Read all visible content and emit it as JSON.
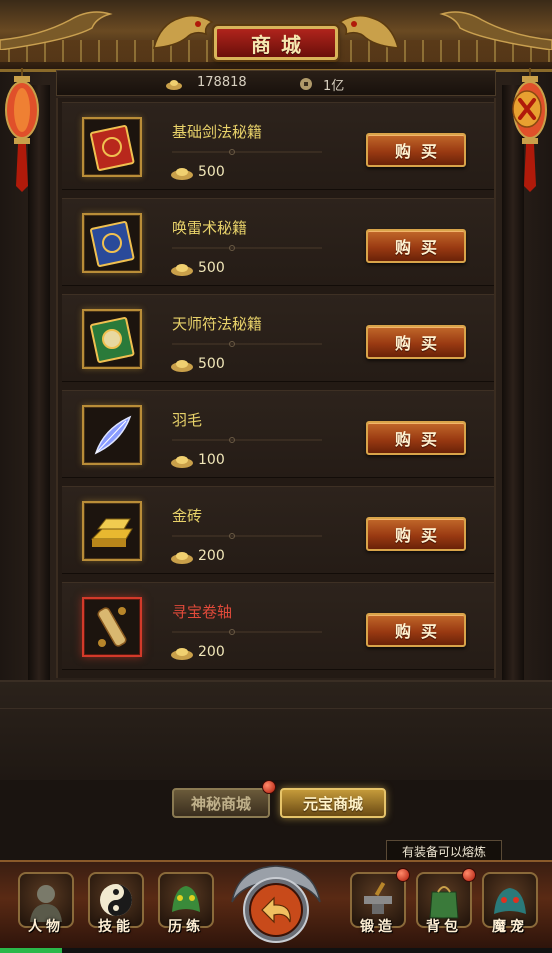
{
  "header": {
    "title": "商城"
  },
  "currency": {
    "gold": "178818",
    "coins": "1亿"
  },
  "items": [
    {
      "name": "基础剑法秘籍",
      "price": "500",
      "icon": "red-book-icon",
      "rare": false
    },
    {
      "name": "唤雷术秘籍",
      "price": "500",
      "icon": "blue-book-icon",
      "rare": false
    },
    {
      "name": "天师符法秘籍",
      "price": "500",
      "icon": "green-book-icon",
      "rare": false
    },
    {
      "name": "羽毛",
      "price": "100",
      "icon": "feather-icon",
      "rare": false
    },
    {
      "name": "金砖",
      "price": "200",
      "icon": "gold-bar-icon",
      "rare": false
    },
    {
      "name": "寻宝卷轴",
      "price": "200",
      "icon": "scroll-icon",
      "rare": true
    }
  ],
  "buy_label": "购买",
  "tabs": [
    {
      "label": "神秘商城",
      "active": false
    },
    {
      "label": "元宝商城",
      "active": true
    }
  ],
  "tooltip": "有装备可以熔炼",
  "nav": [
    {
      "label": "人物",
      "icon": "warrior-icon"
    },
    {
      "label": "技能",
      "icon": "yin-yang-icon"
    },
    {
      "label": "历练",
      "icon": "dragon-head-icon"
    },
    {
      "label": "锻造",
      "icon": "anvil-icon"
    },
    {
      "label": "背包",
      "icon": "backpack-icon"
    },
    {
      "label": "魔宠",
      "icon": "beast-icon"
    }
  ],
  "colors": {
    "item_name": "#e8d26a",
    "rare_name": "#e04a3a",
    "buy_button": "#9a3a12",
    "frame_gold": "#b98d38"
  }
}
